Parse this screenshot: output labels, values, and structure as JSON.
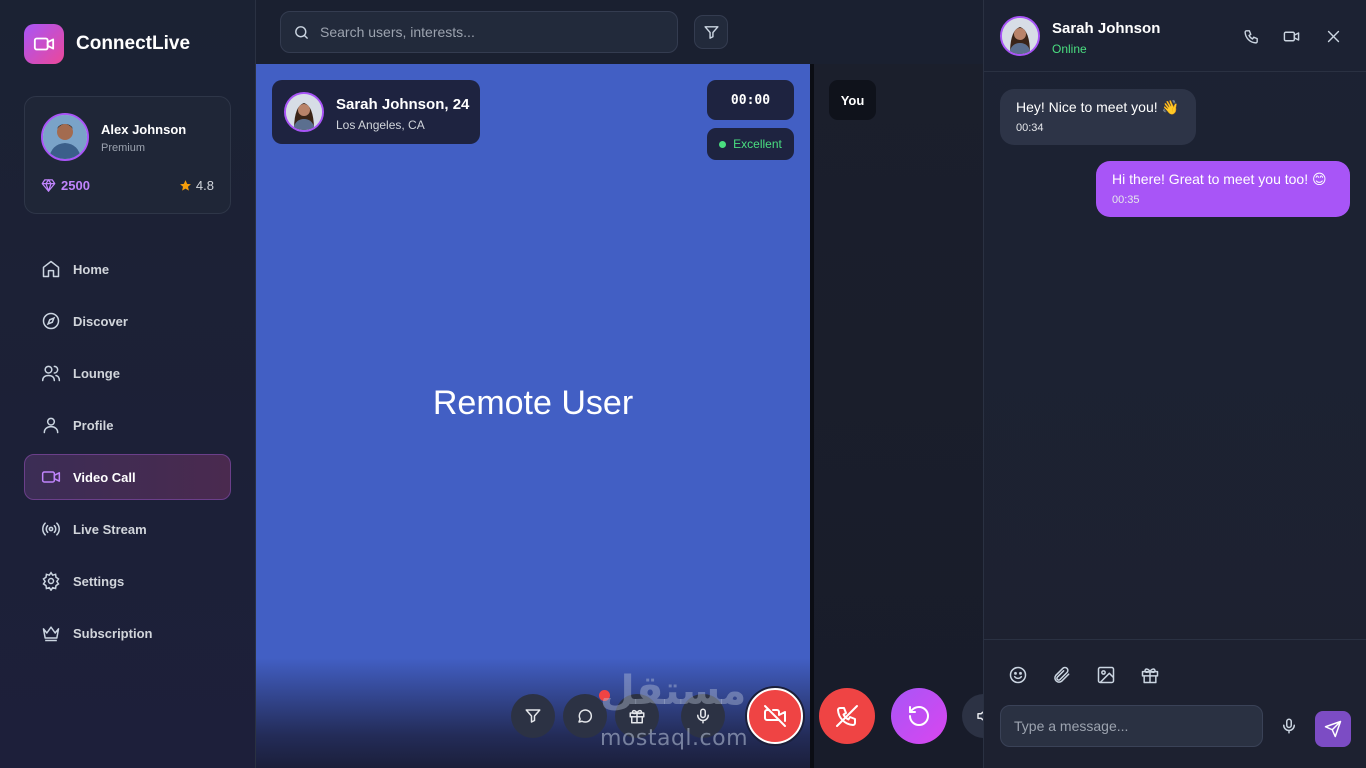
{
  "brand": {
    "name": "ConnectLive",
    "color": "#a855f7"
  },
  "user": {
    "name": "Alex Johnson",
    "tier": "Premium",
    "gems": "2500",
    "rating": "4.8"
  },
  "nav": {
    "items": [
      {
        "label": "Home",
        "icon": "home-icon"
      },
      {
        "label": "Discover",
        "icon": "compass-icon"
      },
      {
        "label": "Lounge",
        "icon": "users-icon"
      },
      {
        "label": "Profile",
        "icon": "user-icon"
      },
      {
        "label": "Video Call",
        "icon": "video-icon",
        "active": true
      },
      {
        "label": "Live Stream",
        "icon": "broadcast-icon"
      },
      {
        "label": "Settings",
        "icon": "gear-icon"
      },
      {
        "label": "Subscription",
        "icon": "crown-icon"
      }
    ]
  },
  "search": {
    "placeholder": "Search users, interests..."
  },
  "call": {
    "remote_name": "Sarah Johnson, 24",
    "remote_location": "Los Angeles, CA",
    "remote_label": "Remote User",
    "timer": "00:00",
    "quality": "Excellent",
    "local_label": "You",
    "colors": {
      "remote_bg": "#425fc4",
      "end_call": "#ef4444",
      "next": "#a855f7"
    }
  },
  "controls": [
    "filter-icon",
    "chat-icon",
    "gift-icon",
    "mic-icon",
    "camera-off-icon",
    "end-call-icon",
    "next-icon",
    "speaker-icon"
  ],
  "chat": {
    "contact_name": "Sarah Johnson",
    "contact_status": "Online",
    "messages": [
      {
        "text": "Hey! Nice to meet you! 👋",
        "time": "00:34",
        "direction": "in"
      },
      {
        "text": "Hi there! Great to meet you too! 😊",
        "time": "00:35",
        "direction": "out"
      }
    ],
    "input_placeholder": "Type a message..."
  },
  "watermark": {
    "latin": "mostaql.com",
    "arabic": "مستقل"
  }
}
